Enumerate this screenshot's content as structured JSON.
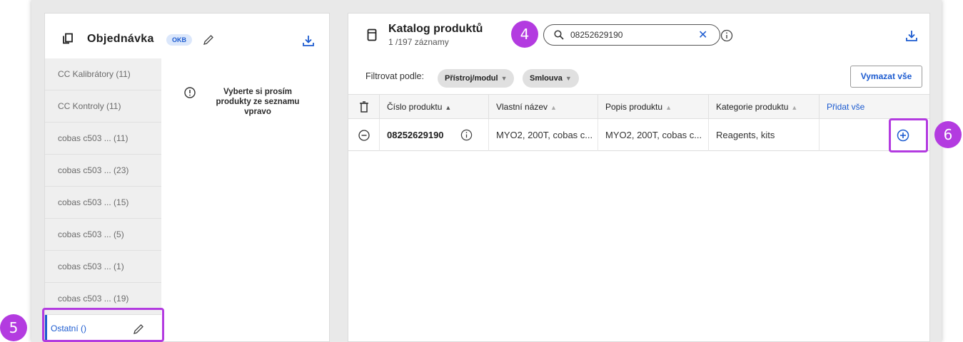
{
  "order_panel": {
    "title": "Objednávka",
    "badge": "OKB",
    "message": "Vyberte si prosím produkty ze seznamu vpravo",
    "categories": [
      {
        "label": "CC Kalibrátory (11)"
      },
      {
        "label": "CC Kontroly (11)"
      },
      {
        "label": "cobas c503 ...  (11)"
      },
      {
        "label": "cobas c503 ...  (23)"
      },
      {
        "label": "cobas c503 ...  (15)"
      },
      {
        "label": "cobas c503 ...  (5)"
      },
      {
        "label": "cobas c503 ...  (1)"
      },
      {
        "label": "cobas c503 ...  (19)"
      }
    ],
    "active_category": "Ostatní ()"
  },
  "catalog_panel": {
    "title": "Katalog produktů",
    "subtitle": "1 /197 záznamy",
    "search": {
      "value": "08252629190",
      "clear_glyph": "✕"
    },
    "filter_label": "Filtrovat podle:",
    "filters": [
      {
        "label": "Přístroj/modul"
      },
      {
        "label": "Smlouva"
      }
    ],
    "clear_all_label": "Vymazat vše",
    "columns": {
      "product_number": "Číslo produktu",
      "own_name": "Vlastní název",
      "description": "Popis produktu",
      "category": "Kategorie produktu",
      "add_all": "Přidat vše"
    },
    "rows": [
      {
        "product_number": "08252629190",
        "own_name": "MYO2, 200T, cobas c...",
        "description": "MYO2, 200T, cobas c...",
        "category": "Reagents, kits"
      }
    ]
  },
  "annotations": {
    "search_marker": "4",
    "category_marker": "5",
    "add_marker": "6"
  },
  "colors": {
    "accent": "#1c5bd0",
    "annotation": "#b33be0",
    "sidebar_bg": "#efefef",
    "badge_bg": "#dbe7fb"
  }
}
